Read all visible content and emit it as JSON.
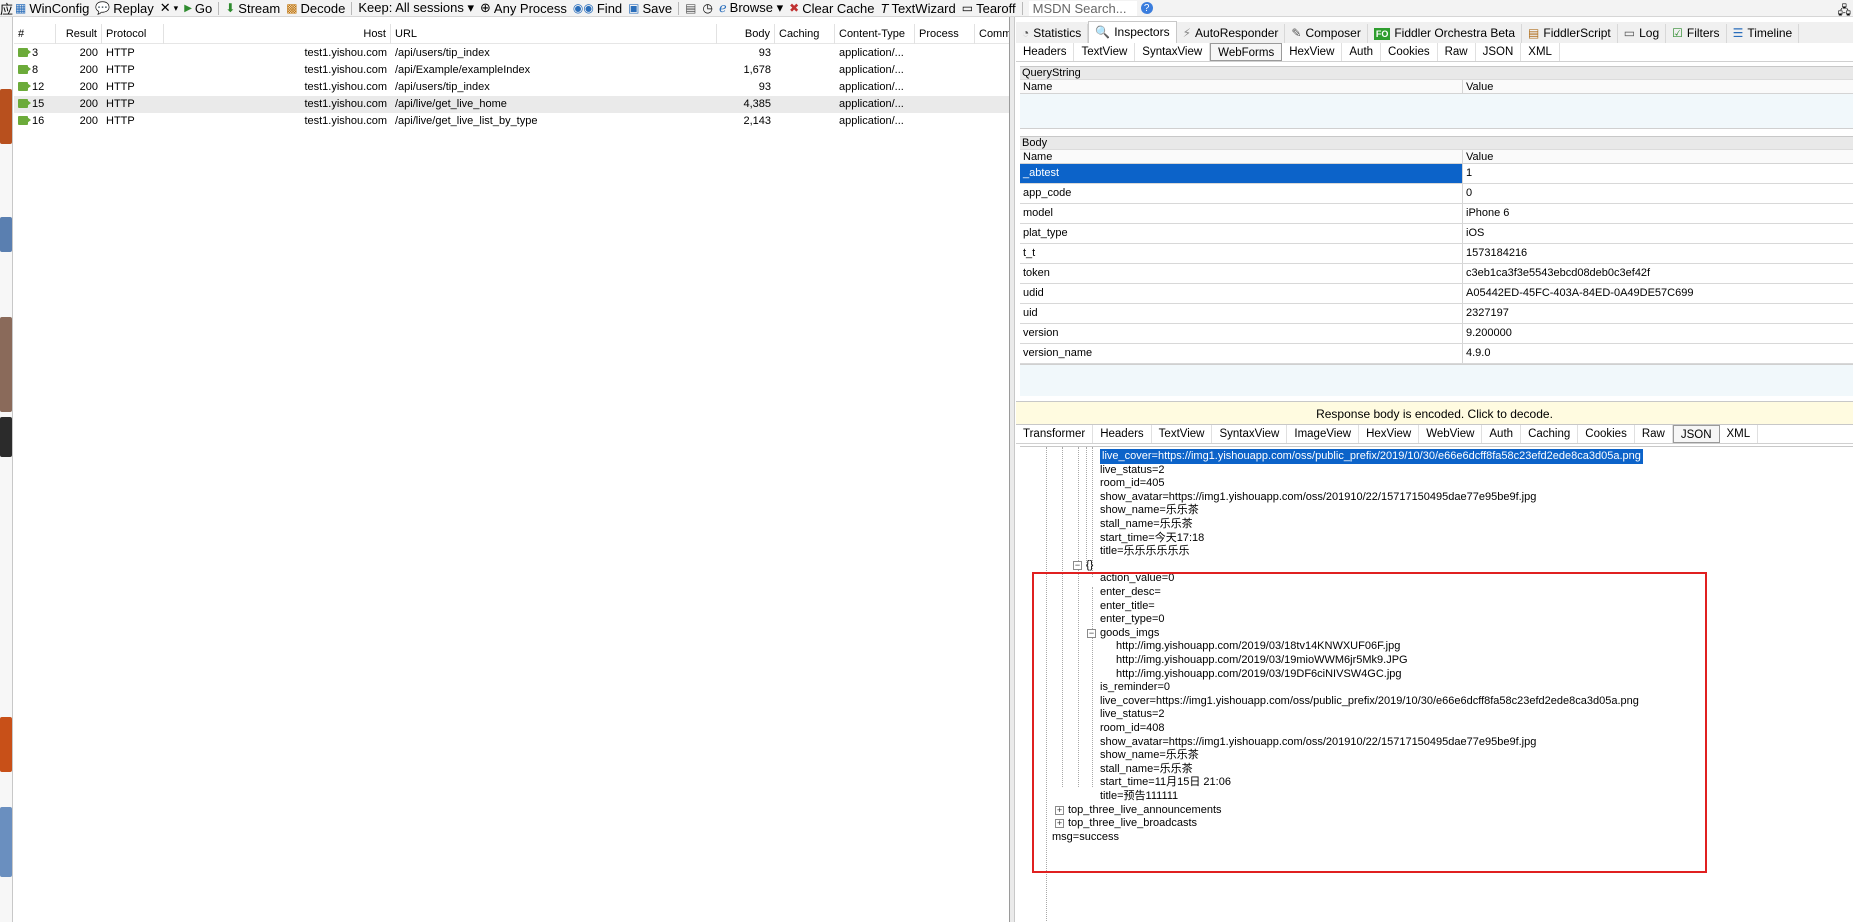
{
  "toolbar": {
    "items": [
      {
        "icon": "window-icon",
        "label": "WinConfig"
      },
      {
        "icon": "comment-icon",
        "label": "Replay"
      },
      {
        "icon": "remove-icon",
        "label": "▾"
      },
      {
        "icon": "play-icon",
        "label": "Go"
      },
      {
        "icon": "stream-icon",
        "label": "Stream"
      },
      {
        "icon": "decode-icon",
        "label": "Decode"
      },
      {
        "icon": "",
        "label": "Keep: All sessions ▾"
      },
      {
        "icon": "target-icon",
        "label": "Any Process"
      },
      {
        "icon": "binoculars-icon",
        "label": "Find"
      },
      {
        "icon": "save-icon",
        "label": "Save"
      },
      {
        "icon": "camera-icon",
        "label": ""
      },
      {
        "icon": "timer-icon",
        "label": ""
      },
      {
        "icon": "browser-icon",
        "label": "Browse ▾"
      },
      {
        "icon": "clear-cache-icon",
        "label": "Clear Cache"
      },
      {
        "icon": "text-wizard-icon",
        "label": "TextWizard"
      },
      {
        "icon": "tearoff-icon",
        "label": "Tearoff"
      }
    ],
    "search_placeholder": "MSDN Search...",
    "help": "?"
  },
  "sessions": {
    "columns": [
      "#",
      "Result",
      "Protocol",
      "Host",
      "URL",
      "Body",
      "Caching",
      "Content-Type",
      "Process",
      "Comments"
    ],
    "rows": [
      {
        "id": "3",
        "result": "200",
        "protocol": "HTTP",
        "host": "test1.yishou.com",
        "url": "/api/users/tip_index",
        "body": "93",
        "caching": "",
        "ctype": "application/...",
        "process": "",
        "comments": ""
      },
      {
        "id": "8",
        "result": "200",
        "protocol": "HTTP",
        "host": "test1.yishou.com",
        "url": "/api/Example/exampleIndex",
        "body": "1,678",
        "caching": "",
        "ctype": "application/...",
        "process": "",
        "comments": ""
      },
      {
        "id": "12",
        "result": "200",
        "protocol": "HTTP",
        "host": "test1.yishou.com",
        "url": "/api/users/tip_index",
        "body": "93",
        "caching": "",
        "ctype": "application/...",
        "process": "",
        "comments": ""
      },
      {
        "id": "15",
        "result": "200",
        "protocol": "HTTP",
        "host": "test1.yishou.com",
        "url": "/api/live/get_live_home",
        "body": "4,385",
        "caching": "",
        "ctype": "application/...",
        "process": "",
        "comments": ""
      },
      {
        "id": "16",
        "result": "200",
        "protocol": "HTTP",
        "host": "test1.yishou.com",
        "url": "/api/live/get_live_list_by_type",
        "body": "2,143",
        "caching": "",
        "ctype": "application/...",
        "process": "",
        "comments": ""
      }
    ]
  },
  "top_tabs": [
    {
      "icon": "statistics-icon",
      "label": "Statistics"
    },
    {
      "icon": "inspectors-icon",
      "label": "Inspectors",
      "active": true
    },
    {
      "icon": "autoresponder-icon",
      "label": "AutoResponder"
    },
    {
      "icon": "composer-icon",
      "label": "Composer"
    },
    {
      "icon": "fo-icon",
      "label": "Fiddler Orchestra Beta",
      "badge": "FO"
    },
    {
      "icon": "fiddlerscript-icon",
      "label": "FiddlerScript"
    },
    {
      "icon": "log-icon",
      "label": "Log"
    },
    {
      "icon": "filters-icon",
      "label": "Filters"
    },
    {
      "icon": "timeline-icon",
      "label": "Timeline"
    }
  ],
  "request_tabs": [
    "Headers",
    "TextView",
    "SyntaxView",
    "WebForms",
    "HexView",
    "Auth",
    "Cookies",
    "Raw",
    "JSON",
    "XML"
  ],
  "request_tab_active": "WebForms",
  "querystring": {
    "title": "QueryString",
    "col_name": "Name",
    "col_value": "Value"
  },
  "body": {
    "title": "Body",
    "col_name": "Name",
    "col_value": "Value",
    "rows": [
      {
        "name": "_abtest",
        "value": "1"
      },
      {
        "name": "app_code",
        "value": "0"
      },
      {
        "name": "model",
        "value": "iPhone 6"
      },
      {
        "name": "plat_type",
        "value": "iOS"
      },
      {
        "name": "t_t",
        "value": "1573184216"
      },
      {
        "name": "token",
        "value": "c3eb1ca3f3e5543ebcd08deb0c3ef42f"
      },
      {
        "name": "udid",
        "value": "A05442ED-45FC-403A-84ED-0A49DE57C699"
      },
      {
        "name": "uid",
        "value": "2327197"
      },
      {
        "name": "version",
        "value": "9.200000"
      },
      {
        "name": "version_name",
        "value": "4.9.0"
      }
    ]
  },
  "response_notice": "Response body is encoded. Click to decode.",
  "response_tabs": [
    "Transformer",
    "Headers",
    "TextView",
    "SyntaxView",
    "ImageView",
    "HexView",
    "WebView",
    "Auth",
    "Caching",
    "Cookies",
    "Raw",
    "JSON",
    "XML"
  ],
  "response_tab_active": "JSON",
  "tree": [
    {
      "text": "live_cover=https://img1.yishouapp.com/oss/public_prefix/2019/10/30/e66e6dcff8fa58c23efd2ede8ca3d05a.png",
      "level": 4,
      "selected": true
    },
    {
      "text": "live_status=2",
      "level": 4
    },
    {
      "text": "room_id=405",
      "level": 4
    },
    {
      "text": "show_avatar=https://img1.yishouapp.com/oss/201910/22/15717150495dae77e95be9f.jpg",
      "level": 4
    },
    {
      "text": "show_name=乐乐茶",
      "level": 4
    },
    {
      "text": "stall_name=乐乐茶",
      "level": 4
    },
    {
      "text": "start_time=今天17:18",
      "level": 4
    },
    {
      "text": "title=乐乐乐乐乐乐",
      "level": 4
    },
    {
      "text": "{}",
      "level": 3,
      "expander": "−"
    },
    {
      "text": "action_value=0",
      "level": 4
    },
    {
      "text": "enter_desc=",
      "level": 4
    },
    {
      "text": "enter_title=",
      "level": 4
    },
    {
      "text": "enter_type=0",
      "level": 4
    },
    {
      "text": "goods_imgs",
      "level": 4,
      "expander": "−"
    },
    {
      "text": "http://img.yishouapp.com/2019/03/18tv14KNWXUF06F.jpg",
      "level": 5
    },
    {
      "text": "http://img.yishouapp.com/2019/03/19mioWWM6jr5Mk9.JPG",
      "level": 5
    },
    {
      "text": "http://img.yishouapp.com/2019/03/19DF6ciNIVSW4GC.jpg",
      "level": 5
    },
    {
      "text": "is_reminder=0",
      "level": 4
    },
    {
      "text": "live_cover=https://img1.yishouapp.com/oss/public_prefix/2019/10/30/e66e6dcff8fa58c23efd2ede8ca3d05a.png",
      "level": 4
    },
    {
      "text": "live_status=2",
      "level": 4
    },
    {
      "text": "room_id=408",
      "level": 4
    },
    {
      "text": "show_avatar=https://img1.yishouapp.com/oss/201910/22/15717150495dae77e95be9f.jpg",
      "level": 4
    },
    {
      "text": "show_name=乐乐茶",
      "level": 4
    },
    {
      "text": "stall_name=乐乐茶",
      "level": 4
    },
    {
      "text": "start_time=11月15日 21:06",
      "level": 4
    },
    {
      "text": "title=预告111111",
      "level": 4
    },
    {
      "text": "top_three_live_announcements",
      "level": 2,
      "expander": "+"
    },
    {
      "text": "top_three_live_broadcasts",
      "level": 2,
      "expander": "+"
    },
    {
      "text": "msg=success",
      "level": 1
    }
  ],
  "colors": {
    "selection": "#0c63c9",
    "highlight_box": "#e02020",
    "notice_bg": "#fffbe0",
    "session_icon": "#6cab3a"
  }
}
